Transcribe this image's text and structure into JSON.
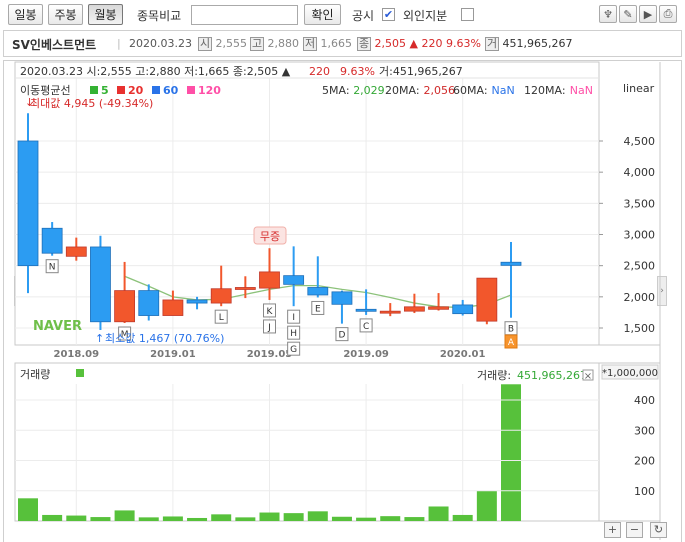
{
  "toolbar": {
    "daily": "일봉",
    "weekly": "주봉",
    "monthly": "월봉",
    "compare_label": "종목비교",
    "compare_value": "",
    "confirm": "확인",
    "disclosure": "공시",
    "foreign": "외인지분"
  },
  "info": {
    "name": "SV인베스트먼트",
    "date": "2020.03.23",
    "open_icon": "시",
    "open": "2,555",
    "high_icon": "고",
    "high": "2,880",
    "low_icon": "저",
    "low": "1,665",
    "close_icon": "종",
    "close": "2,505",
    "change": "▲ 220",
    "pct": "9.63%",
    "vol_icon": "거",
    "volume": "451,965,267"
  },
  "price_pane": {
    "header": "2020.03.23 시:2,555 고:2,880 저:1,665 종:2,505 ▲",
    "header_change": "220",
    "header_pct": "9.63%",
    "header_vol": "거:451,965,267",
    "ma_title": "이동평균선",
    "ma_legend": [
      {
        "label": "5",
        "color": "#34b233"
      },
      {
        "label": "20",
        "color": "#e8312f"
      },
      {
        "label": "60",
        "color": "#2a73e8"
      },
      {
        "label": "120",
        "color": "#ff4fa7"
      }
    ],
    "ma_values": [
      {
        "label": "5MA:",
        "value": "2,029",
        "color": "#34a836"
      },
      {
        "label": "20MA:",
        "value": "2,056",
        "color": "#d02a2a"
      },
      {
        "label": "60MA:",
        "value": "NaN",
        "color": "#2a73e8"
      },
      {
        "label": "120MA:",
        "value": "NaN",
        "color": "#ff4fa7"
      }
    ],
    "scale": "linear",
    "max_label": "최대값 4,945 (-49.34%)",
    "min_label": "최소값 1,467 (70.76%)",
    "issue_label": "무증",
    "watermark": "NAVER"
  },
  "volume_pane": {
    "title": "거래량",
    "current_label": "거래량:",
    "current_value": "451,965,267",
    "unit": "*1,000,000",
    "close_icon": "×"
  },
  "colors": {
    "up": "#f2572c",
    "down": "#2c9cf2",
    "ma5": "#8cc27a",
    "volume": "#57c13b",
    "up_border": "#c0392b",
    "down_border": "#1f6fb8"
  },
  "chart_data": [
    {
      "type": "candlestick",
      "title": "SV인베스트먼트 월봉",
      "ylabel": "",
      "y_ticks": [
        1500,
        2000,
        2500,
        3000,
        3500,
        4000,
        4500
      ],
      "y_tick_labels": [
        "1,500",
        "2,000",
        "2,500",
        "3,000",
        "3,500",
        "4,000",
        "4,500"
      ],
      "ylim": [
        1100,
        5000
      ],
      "x_tick_labels": [
        {
          "label": "2018.09",
          "index": 2
        },
        {
          "label": "2019.01",
          "index": 6
        },
        {
          "label": "2019.05",
          "index": 10
        },
        {
          "label": "2019.09",
          "index": 14
        },
        {
          "label": "2020.01",
          "index": 18
        }
      ],
      "candles": [
        {
          "o": 4500,
          "c": 2500,
          "h": 4945,
          "l": 2060
        },
        {
          "o": 3100,
          "c": 2700,
          "h": 3200,
          "l": 2660
        },
        {
          "o": 2650,
          "c": 2800,
          "h": 2950,
          "l": 2580
        },
        {
          "o": 2800,
          "c": 1600,
          "h": 2980,
          "l": 1467
        },
        {
          "o": 1600,
          "c": 2100,
          "h": 2560,
          "l": 1580
        },
        {
          "o": 2100,
          "c": 1700,
          "h": 2200,
          "l": 1620
        },
        {
          "o": 1700,
          "c": 1950,
          "h": 2100,
          "l": 1700
        },
        {
          "o": 1950,
          "c": 1900,
          "h": 2000,
          "l": 1800
        },
        {
          "o": 1900,
          "c": 2130,
          "h": 2500,
          "l": 1850
        },
        {
          "o": 2150,
          "c": 2150,
          "h": 2330,
          "l": 1980
        },
        {
          "o": 2140,
          "c": 2400,
          "h": 2780,
          "l": 1950
        },
        {
          "o": 2340,
          "c": 2200,
          "h": 2810,
          "l": 1850
        },
        {
          "o": 2150,
          "c": 2030,
          "h": 2650,
          "l": 1990
        },
        {
          "o": 2080,
          "c": 1880,
          "h": 2100,
          "l": 1570
        },
        {
          "o": 1800,
          "c": 1790,
          "h": 2120,
          "l": 1710
        },
        {
          "o": 1770,
          "c": 1770,
          "h": 1900,
          "l": 1690
        },
        {
          "o": 1770,
          "c": 1840,
          "h": 2050,
          "l": 1740
        },
        {
          "o": 1800,
          "c": 1840,
          "h": 2060,
          "l": 1780
        },
        {
          "o": 1870,
          "c": 1730,
          "h": 1950,
          "l": 1700
        },
        {
          "o": 1610,
          "c": 2300,
          "h": 2300,
          "l": 1560
        },
        {
          "o": 2555,
          "c": 2505,
          "h": 2880,
          "l": 1665
        }
      ],
      "ma5_series": [
        null,
        null,
        null,
        null,
        2330,
        2170,
        2000,
        1950,
        1960,
        2040,
        2120,
        2180,
        2180,
        2120,
        2070,
        1990,
        1900,
        1840,
        1830,
        1880,
        2029
      ],
      "event_markers": [
        "N",
        "M",
        "L",
        "K",
        "J",
        "I",
        "H",
        "G",
        "E",
        "D",
        "C",
        "B",
        "A"
      ],
      "event_indices": [
        1,
        4,
        8,
        10,
        10,
        11,
        11,
        11,
        12,
        13,
        14,
        20,
        20
      ]
    },
    {
      "type": "bar",
      "title": "거래량",
      "ylabel": "",
      "unit": "*1,000,000",
      "y_ticks": [
        100,
        200,
        300,
        400
      ],
      "ylim": [
        0,
        475
      ],
      "values": [
        75,
        20,
        18,
        13,
        35,
        12,
        15,
        10,
        22,
        12,
        28,
        26,
        32,
        14,
        11,
        16,
        13,
        48,
        20,
        100,
        451.97
      ]
    }
  ]
}
